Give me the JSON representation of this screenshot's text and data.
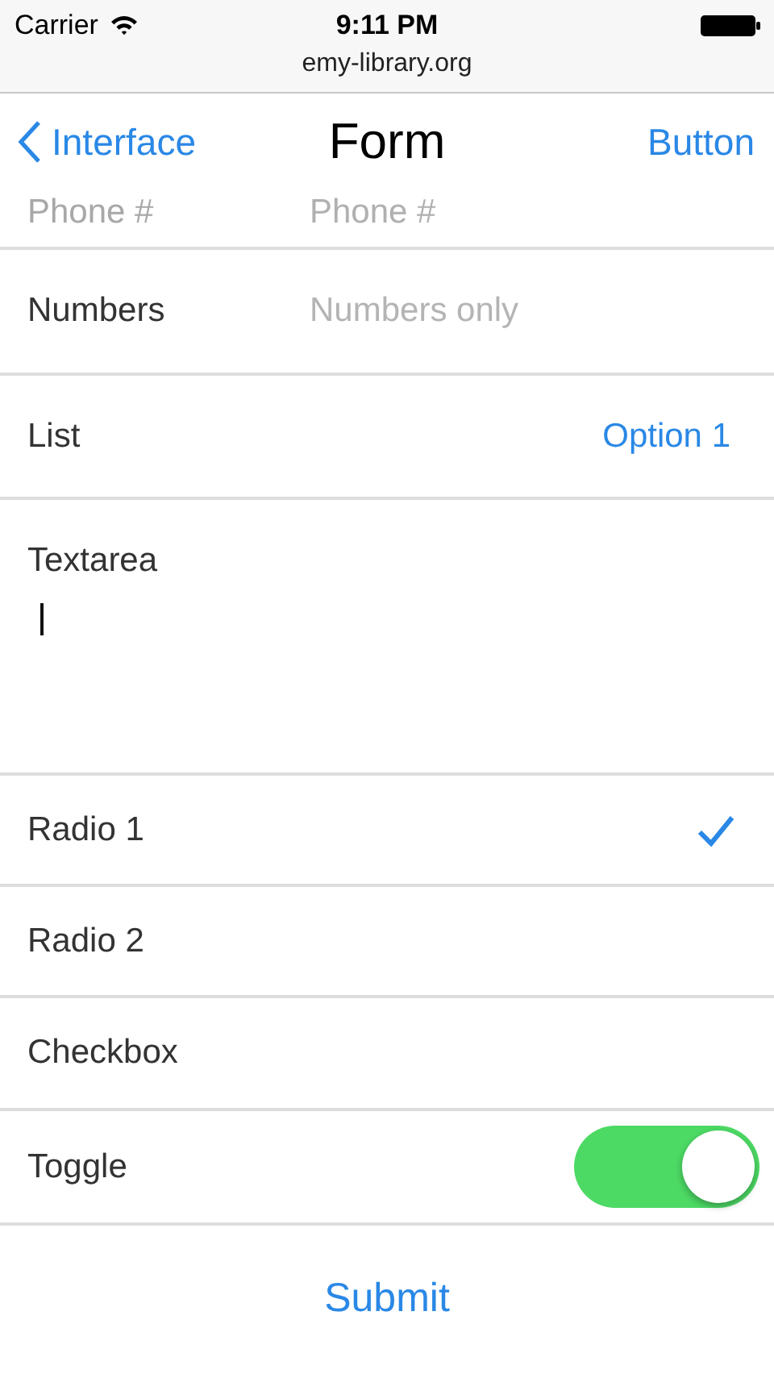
{
  "status_bar": {
    "carrier": "Carrier",
    "time": "9:11 PM"
  },
  "address_bar": {
    "url": "emy-library.org"
  },
  "nav": {
    "back": "Interface",
    "title": "Form",
    "action": "Button"
  },
  "fields": [
    {
      "kind": "text",
      "label": "Phone #",
      "placeholder": "Phone #"
    },
    {
      "kind": "text",
      "label": "Numbers",
      "placeholder": "Numbers only"
    },
    {
      "kind": "select",
      "label": "List",
      "value": "Option 1"
    },
    {
      "kind": "textarea",
      "label": "Textarea",
      "focused": true
    },
    {
      "kind": "radio",
      "label": "Radio 1",
      "selected": true
    },
    {
      "kind": "radio",
      "label": "Radio 2",
      "selected": false
    },
    {
      "kind": "checkbox",
      "label": "Checkbox",
      "checked": false
    },
    {
      "kind": "toggle",
      "label": "Toggle",
      "on": true
    }
  ],
  "submit": "Submit"
}
